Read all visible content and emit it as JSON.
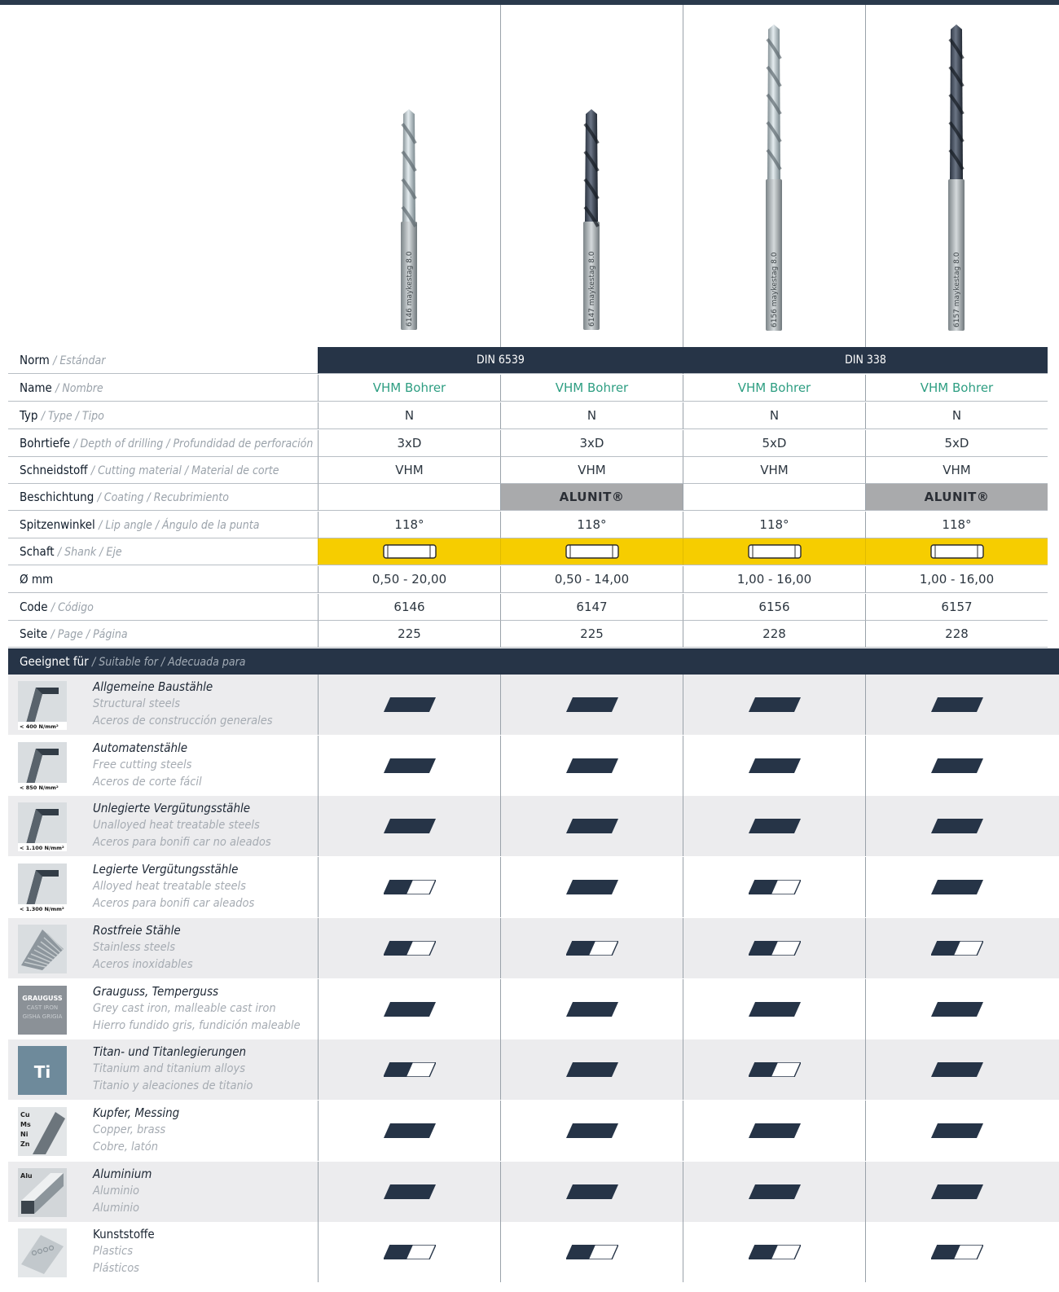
{
  "products": [
    {
      "norm": "DIN 6539",
      "name": "VHM Bohrer",
      "typ": "N",
      "depth": "3xD",
      "material": "VHM",
      "coating": "",
      "angle": "118°",
      "diameter": "0,50 - 20,00",
      "code": "6146",
      "page": "225",
      "drill_label": "6146 maykestag 8.0",
      "drill_color": "silver"
    },
    {
      "norm": "DIN 6539",
      "name": "VHM Bohrer",
      "typ": "N",
      "depth": "3xD",
      "material": "VHM",
      "coating": "ALUNIT®",
      "angle": "118°",
      "diameter": "0,50 - 14,00",
      "code": "6147",
      "page": "225",
      "drill_label": "6147 maykestag 8.0",
      "drill_color": "dark"
    },
    {
      "norm": "DIN 338",
      "name": "VHM Bohrer",
      "typ": "N",
      "depth": "5xD",
      "material": "VHM",
      "coating": "",
      "angle": "118°",
      "diameter": "1,00 - 16,00",
      "code": "6156",
      "page": "228",
      "drill_label": "6156 maykestag 8.0",
      "drill_color": "silver"
    },
    {
      "norm": "DIN 338",
      "name": "VHM Bohrer",
      "typ": "N",
      "depth": "5xD",
      "material": "VHM",
      "coating": "ALUNIT®",
      "angle": "118°",
      "diameter": "1,00 - 16,00",
      "code": "6157",
      "page": "228",
      "drill_label": "6157 maykestag 8.0",
      "drill_color": "dark"
    }
  ],
  "norm_groups": [
    "DIN 6539",
    "DIN 338"
  ],
  "labels": {
    "norm": {
      "de": "Norm",
      "other": "/ Estándar"
    },
    "name": {
      "de": "Name",
      "other": "/ Nombre"
    },
    "typ": {
      "de": "Typ",
      "other": "/ Type / Tipo"
    },
    "depth": {
      "de": "Bohrtiefe",
      "other": "/ Depth of  drilling / Profundidad de perforación"
    },
    "material": {
      "de": "Schneidstoff",
      "other": "/ Cutting material / Material de corte"
    },
    "coating": {
      "de": "Beschichtung",
      "other": "/ Coating / Recubrimiento"
    },
    "angle": {
      "de": "Spitzenwinkel",
      "other": "/ Lip angle / Ángulo de la punta"
    },
    "shank": {
      "de": "Schaft",
      "other": "/ Shank / Eje"
    },
    "diameter": {
      "de": "Ø mm",
      "other": ""
    },
    "code": {
      "de": "Code",
      "other": "/ Código"
    },
    "page": {
      "de": "Seite",
      "other": "/ Page / Página"
    }
  },
  "section": {
    "de": "Geeignet für",
    "other": "/ Suitable for / Adecuada para"
  },
  "materials": [
    {
      "de": "Allgemeine Baustähle",
      "en": "Structural steels",
      "es": "Aceros de construcción generales",
      "icon": "steel-profile-icon",
      "badge": "< 400 N/mm²",
      "suitability": [
        "full",
        "full",
        "full",
        "full"
      ]
    },
    {
      "de": "Automatenstähle",
      "en": "Free cutting steels",
      "es": "Aceros de corte fácil",
      "icon": "steel-profile-icon",
      "badge": "< 850 N/mm²",
      "suitability": [
        "full",
        "full",
        "full",
        "full"
      ]
    },
    {
      "de": "Unlegierte Vergütungsstähle",
      "en": "Unalloyed heat treatable steels",
      "es": "Aceros para bonifi car no aleados",
      "icon": "steel-profile-icon",
      "badge": "< 1.100 N/mm²",
      "suitability": [
        "full",
        "full",
        "full",
        "full"
      ]
    },
    {
      "de": "Legierte Vergütungsstähle",
      "en": "Alloyed heat treatable steels",
      "es": "Aceros para bonifi car aleados",
      "icon": "steel-profile-icon",
      "badge": "< 1.300 N/mm²",
      "suitability": [
        "half",
        "full",
        "half",
        "full"
      ]
    },
    {
      "de": "Rostfreie Stähle",
      "en": "Stainless steels",
      "es": "Aceros inoxidables",
      "icon": "stainless-plate-icon",
      "badge": "",
      "suitability": [
        "half",
        "half",
        "half",
        "half"
      ]
    },
    {
      "de": "Grauguss, Temperguss",
      "en": "Grey cast iron, malleable cast iron",
      "es": "Hierro fundido gris, fundición maleable",
      "icon": "cast-iron-icon",
      "badge": "GRAUGUSS|CAST IRON|GISHA GRIGIA",
      "suitability": [
        "full",
        "full",
        "full",
        "full"
      ]
    },
    {
      "de": "Titan- und Titanlegierungen",
      "en": "Titanium and titanium alloys",
      "es": "Titanio y aleaciones de titanio",
      "icon": "titanium-icon",
      "badge": "Ti",
      "suitability": [
        "half",
        "full",
        "half",
        "full"
      ]
    },
    {
      "de": "Kupfer, Messing",
      "en": "Copper, brass",
      "es": "Cobre, latón",
      "icon": "copper-brass-icon",
      "badge": "Cu|Ms|Ni|Zn",
      "suitability": [
        "full",
        "full",
        "full",
        "full"
      ]
    },
    {
      "de": "Aluminium",
      "en": "Aluminio",
      "es": "Aluminio",
      "icon": "aluminium-icon",
      "badge": "Alu",
      "suitability": [
        "full",
        "full",
        "full",
        "full"
      ]
    },
    {
      "de": "Kunststoffe",
      "en": "Plastics",
      "es": "Plásticos",
      "icon": "plastics-icon",
      "badge": "",
      "suitability": [
        "half",
        "half",
        "half",
        "half"
      ]
    }
  ],
  "colors": {
    "navy": "#263447",
    "green": "#2e9e82",
    "yellow": "#f6cd00",
    "grey": "#a9aaac"
  }
}
